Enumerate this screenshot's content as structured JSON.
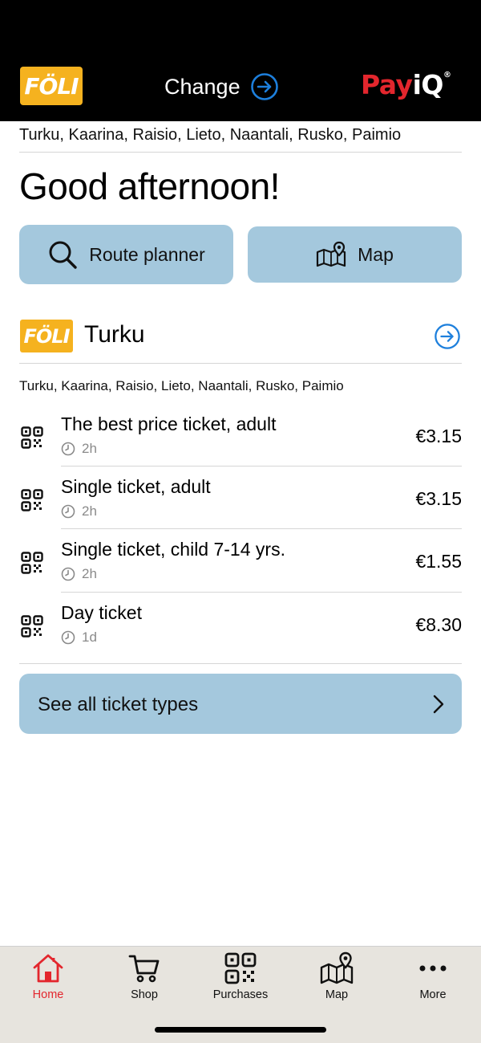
{
  "header": {
    "operator_logo_text": "FÖLI",
    "change_label": "Change",
    "brand_pay": "Pay",
    "brand_iq": "iQ",
    "brand_mark": "®"
  },
  "region_text": "Turku, Kaarina, Raisio, Lieto, Naantali, Rusko, Paimio",
  "greeting": "Good afternoon!",
  "actions": {
    "route_planner_label": "Route planner",
    "map_label": "Map"
  },
  "operator": {
    "logo_text": "FÖLI",
    "name": "Turku",
    "region_text": "Turku, Kaarina, Raisio, Lieto, Naantali, Rusko, Paimio"
  },
  "tickets": [
    {
      "name": "The best price ticket, adult",
      "duration": "2h",
      "price": "€3.15"
    },
    {
      "name": "Single ticket, adult",
      "duration": "2h",
      "price": "€3.15"
    },
    {
      "name": "Single ticket, child 7-14 yrs.",
      "duration": "2h",
      "price": "€1.55"
    },
    {
      "name": "Day ticket",
      "duration": "1d",
      "price": "€8.30"
    }
  ],
  "see_all_label": "See all ticket types",
  "tabs": [
    {
      "label": "Home",
      "icon": "home-icon",
      "active": true
    },
    {
      "label": "Shop",
      "icon": "cart-icon",
      "active": false
    },
    {
      "label": "Purchases",
      "icon": "qr-code-icon",
      "active": false
    },
    {
      "label": "Map",
      "icon": "map-icon",
      "active": false
    },
    {
      "label": "More",
      "icon": "more-icon",
      "active": false
    }
  ],
  "colors": {
    "topbar": "#000000",
    "foli_yellow": "#f5b21f",
    "accent_blue": "#1d7fdc",
    "button_blue": "#a4c8dd",
    "active_red": "#e3262d",
    "tabbar": "#e7e4de"
  }
}
